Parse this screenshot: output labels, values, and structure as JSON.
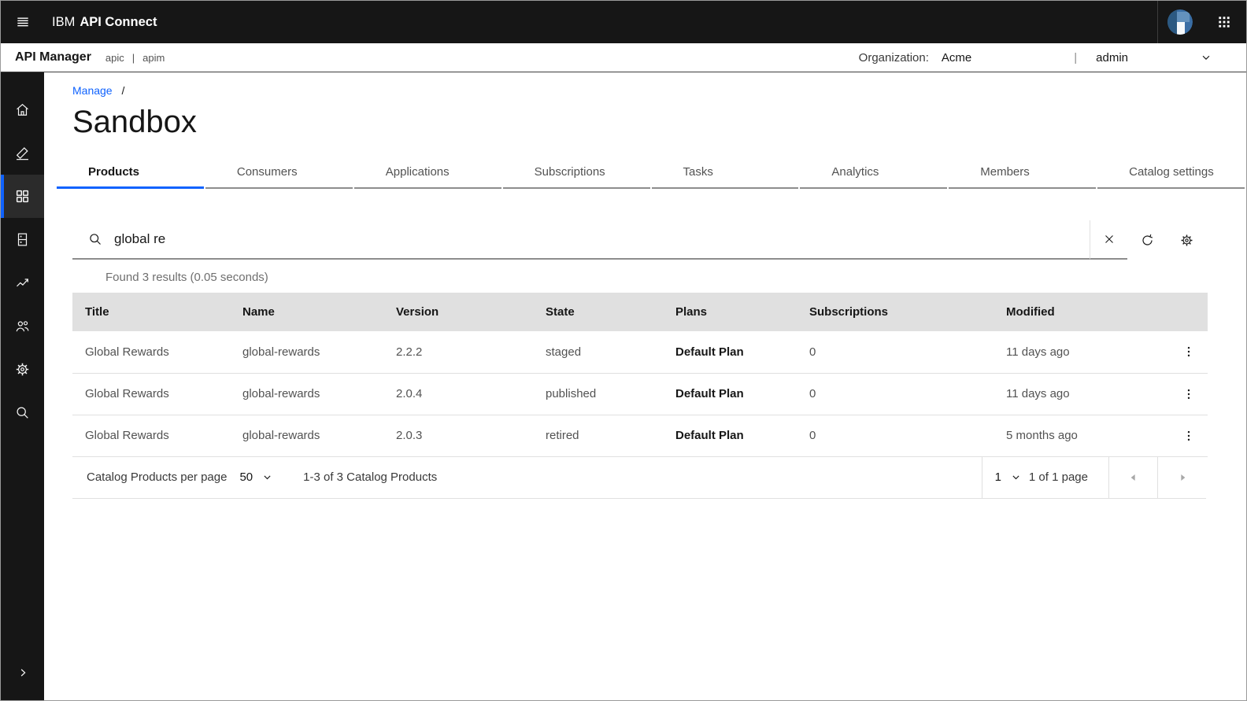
{
  "topbar": {
    "brand_prefix": "IBM",
    "brand_name": "API Connect",
    "menu_icon": "hamburger-menu-icon",
    "avatar_icon": "avatar-logo-icon",
    "app_switcher_icon": "app-switcher-icon"
  },
  "subbar": {
    "app_title": "API Manager",
    "env_left": "apic",
    "env_divider": "|",
    "env_right": "apim",
    "org_label": "Organization:",
    "org_value": "Acme",
    "divider": "|",
    "user_value": "admin",
    "user_chevron_icon": "chevron-down-icon"
  },
  "sidebar": {
    "items": [
      {
        "icon": "home-icon",
        "active": false
      },
      {
        "icon": "edit-icon",
        "active": false
      },
      {
        "icon": "grid-icon",
        "active": true
      },
      {
        "icon": "catalog-icon",
        "active": false
      },
      {
        "icon": "analytics-icon",
        "active": false
      },
      {
        "icon": "people-icon",
        "active": false
      },
      {
        "icon": "settings-icon",
        "active": false
      },
      {
        "icon": "search-icon",
        "active": false
      }
    ],
    "expand_icon": "chevron-right-icon"
  },
  "breadcrumb": {
    "link": "Manage",
    "separator": "/"
  },
  "page_title": "Sandbox",
  "tabs": [
    {
      "label": "Products",
      "active": true
    },
    {
      "label": "Consumers",
      "active": false
    },
    {
      "label": "Applications",
      "active": false
    },
    {
      "label": "Subscriptions",
      "active": false
    },
    {
      "label": "Tasks",
      "active": false
    },
    {
      "label": "Analytics",
      "active": false
    },
    {
      "label": "Members",
      "active": false
    },
    {
      "label": "Catalog settings",
      "active": false
    }
  ],
  "search": {
    "value": "global re",
    "left_icon": "search-icon",
    "toolbar_icons": [
      "clear-icon",
      "refresh-icon",
      "settings-icon"
    ],
    "results_text": "Found 3 results (0.05 seconds)"
  },
  "table": {
    "columns": [
      "Title",
      "Name",
      "Version",
      "State",
      "Plans",
      "Subscriptions",
      "Modified"
    ],
    "row_action_icon": "kebab-menu-icon",
    "rows": [
      {
        "title": "Global Rewards",
        "name": "global-rewards",
        "version": "2.2.2",
        "state": "staged",
        "plans": "Default Plan",
        "subscriptions": "0",
        "modified": "11 days ago"
      },
      {
        "title": "Global Rewards",
        "name": "global-rewards",
        "version": "2.0.4",
        "state": "published",
        "plans": "Default Plan",
        "subscriptions": "0",
        "modified": "11 days ago"
      },
      {
        "title": "Global Rewards",
        "name": "global-rewards",
        "version": "2.0.3",
        "state": "retired",
        "plans": "Default Plan",
        "subscriptions": "0",
        "modified": "5 months ago"
      }
    ]
  },
  "pagination": {
    "per_page_label": "Catalog Products per page",
    "per_page_value": "50",
    "range_text": "1-3 of 3 Catalog Products",
    "page_value": "1",
    "page_text": "1 of 1 page",
    "prev_icon": "caret-left-icon",
    "next_icon": "caret-right-icon"
  },
  "colors": {
    "header_bg": "#161616",
    "accent_blue": "#0f62fe",
    "table_header_bg": "#e0e0e0",
    "border_gray": "#e0e0e0",
    "underline_gray": "#8d8d8d"
  }
}
